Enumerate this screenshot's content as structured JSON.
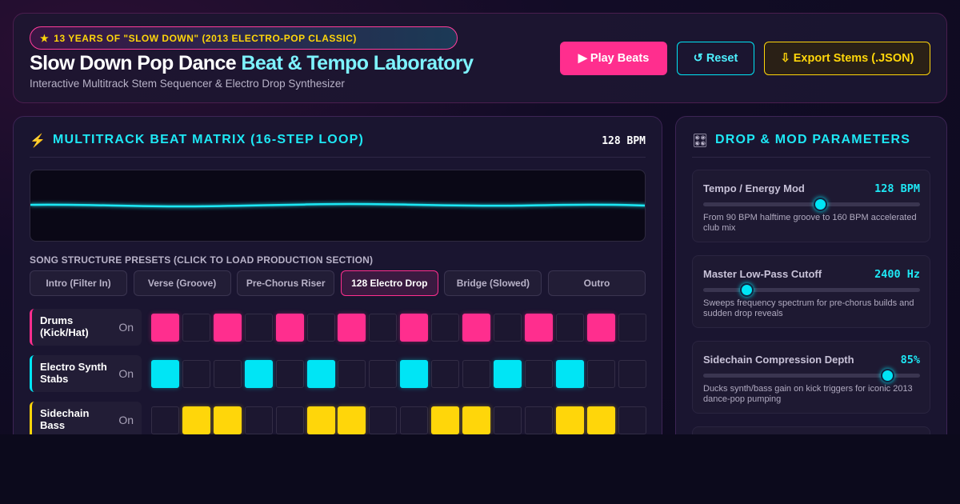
{
  "header": {
    "badge_icon": "star-icon",
    "badge": "13 YEARS OF \"SLOW DOWN\" (2013 ELECTRO-POP CLASSIC)",
    "title_main": "Slow Down Pop Dance ",
    "title_highlight": "Beat & Tempo Laboratory",
    "subtitle": "Interactive Multitrack Stem Sequencer & Electro Drop Synthesizer",
    "play_label": "▶  Play Beats",
    "reset_label": "↺ Reset",
    "export_label": "⇩ Export Stems (.JSON)"
  },
  "matrix": {
    "icon": "lightning-icon",
    "title": "MULTITRACK BEAT MATRIX (16-STEP LOOP)",
    "bpm": "128 BPM",
    "presets_label": "SONG STRUCTURE PRESETS (CLICK TO LOAD PRODUCTION SECTION)",
    "presets": [
      {
        "label": "Intro (Filter In)",
        "active": false
      },
      {
        "label": "Verse (Groove)",
        "active": false
      },
      {
        "label": "Pre-Chorus Riser",
        "active": false
      },
      {
        "label": "128 Electro Drop",
        "active": true
      },
      {
        "label": "Bridge (Slowed)",
        "active": false
      },
      {
        "label": "Outro",
        "active": false
      }
    ],
    "tracks": [
      {
        "name": "Drums (Kick/Hat)",
        "state": "On",
        "color": "#ff2e8e",
        "steps": [
          1,
          0,
          1,
          0,
          1,
          0,
          1,
          0,
          1,
          0,
          1,
          0,
          1,
          0,
          1,
          0
        ]
      },
      {
        "name": "Electro Synth Stabs",
        "state": "On",
        "color": "#00e5f5",
        "steps": [
          1,
          0,
          0,
          1,
          0,
          1,
          0,
          0,
          1,
          0,
          0,
          1,
          0,
          1,
          0,
          0
        ]
      },
      {
        "name": "Sidechain Bass",
        "state": "On",
        "color": "#ffd60a",
        "steps": [
          0,
          1,
          1,
          0,
          0,
          1,
          1,
          0,
          0,
          1,
          1,
          0,
          0,
          1,
          1,
          0
        ]
      }
    ]
  },
  "params": {
    "icon": "mixer-icon",
    "title": "DROP & MOD PARAMETERS",
    "items": [
      {
        "name": "Tempo / Energy Mod",
        "value": "128 BPM",
        "level": 0.54,
        "desc": "From 90 BPM halftime groove to 160 BPM accelerated club mix"
      },
      {
        "name": "Master Low-Pass Cutoff",
        "value": "2400 Hz",
        "level": 0.2,
        "desc": "Sweeps frequency spectrum for pre-chorus builds and sudden drop reveals"
      },
      {
        "name": "Sidechain Compression Depth",
        "value": "85%",
        "level": 0.85,
        "desc": "Ducks synth/bass gain on kick triggers for iconic 2013 dance-pop pumping"
      }
    ]
  }
}
